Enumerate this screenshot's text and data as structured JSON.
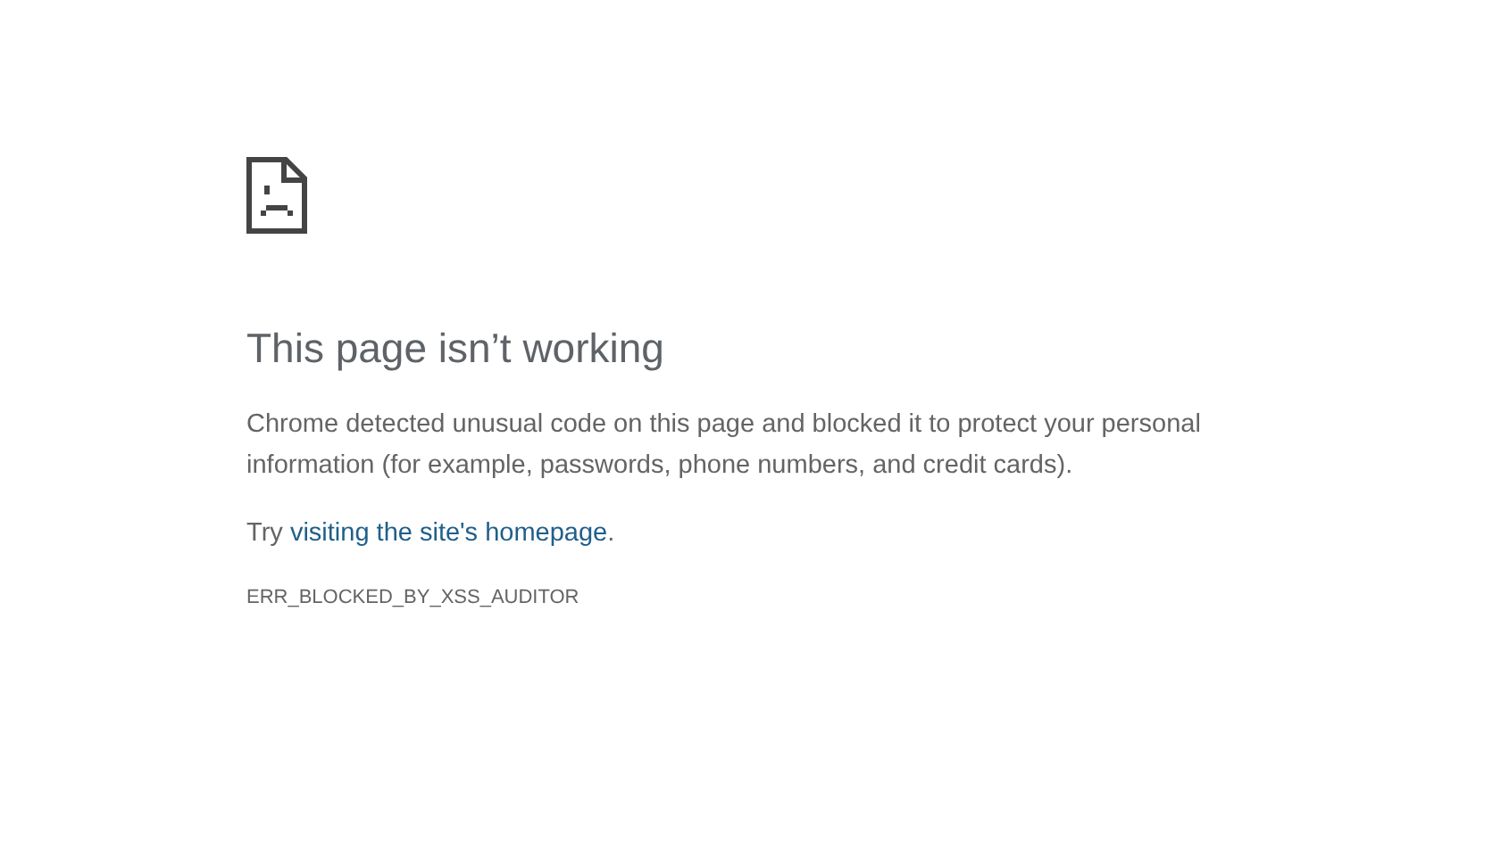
{
  "title": "This page isn’t working",
  "message": "Chrome detected unusual code on this page and blocked it to protect your personal information (for example, passwords, phone numbers, and credit cards).",
  "suggestion": {
    "prefix": "Try",
    "link": "visiting the site's homepage",
    "suffix": "."
  },
  "error_code": "ERR_BLOCKED_BY_XSS_AUDITOR"
}
